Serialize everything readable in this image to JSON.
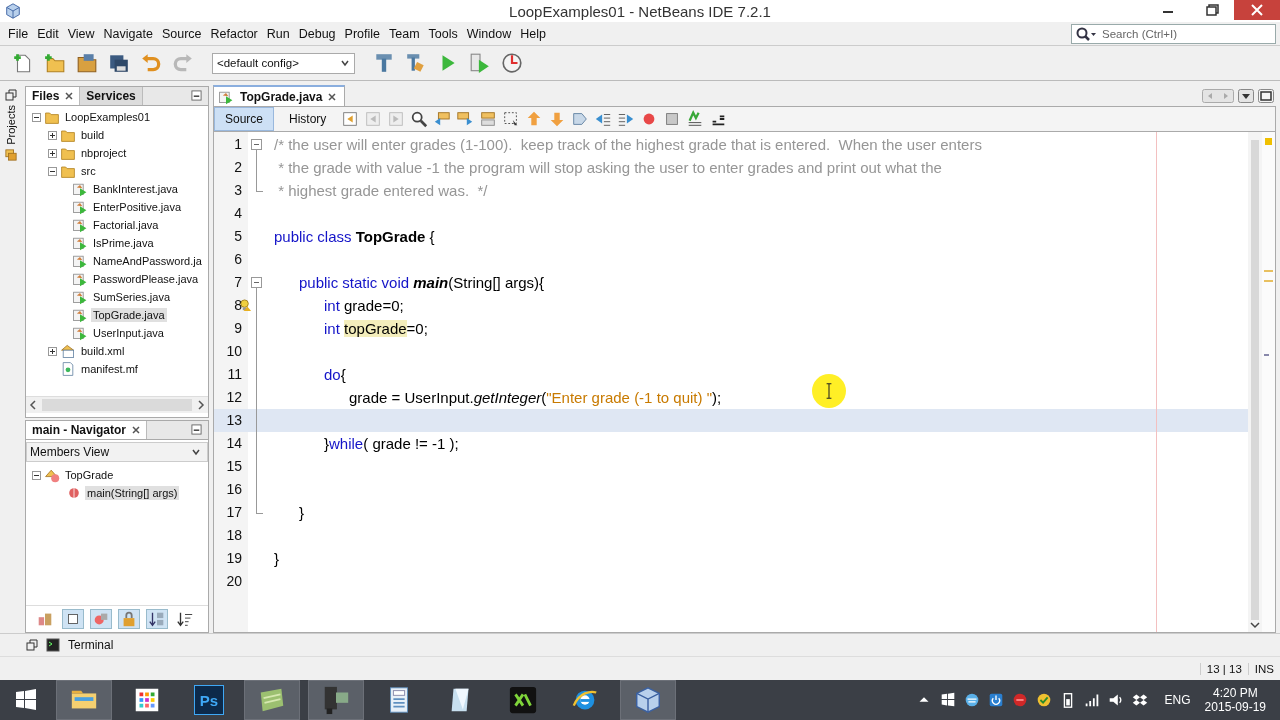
{
  "window": {
    "title": "LoopExamples01 - NetBeans IDE 7.2.1"
  },
  "menu": [
    "File",
    "Edit",
    "View",
    "Navigate",
    "Source",
    "Refactor",
    "Run",
    "Debug",
    "Profile",
    "Team",
    "Tools",
    "Window",
    "Help"
  ],
  "search": {
    "placeholder": "Search (Ctrl+I)"
  },
  "toolbar": {
    "config": "<default config>"
  },
  "side_strip": {
    "label": "Projects"
  },
  "files_panel": {
    "tabs": [
      {
        "label": "Files",
        "selected": true
      },
      {
        "label": "Services",
        "selected": false
      }
    ],
    "tree": [
      {
        "label": "LoopExamples01",
        "kind": "project",
        "expanded": true,
        "selected": false,
        "children": [
          {
            "label": "build",
            "kind": "folder",
            "expanded": false,
            "selected": false
          },
          {
            "label": "nbproject",
            "kind": "folder",
            "expanded": false,
            "selected": false
          },
          {
            "label": "src",
            "kind": "folder",
            "expanded": true,
            "selected": false,
            "children": [
              {
                "label": "BankInterest.java",
                "kind": "java",
                "selected": false
              },
              {
                "label": "EnterPositive.java",
                "kind": "java",
                "selected": false
              },
              {
                "label": "Factorial.java",
                "kind": "java",
                "selected": false
              },
              {
                "label": "IsPrime.java",
                "kind": "java",
                "selected": false
              },
              {
                "label": "NameAndPassword.ja",
                "kind": "java",
                "selected": false
              },
              {
                "label": "PasswordPlease.java",
                "kind": "java",
                "selected": false
              },
              {
                "label": "SumSeries.java",
                "kind": "java",
                "selected": false
              },
              {
                "label": "TopGrade.java",
                "kind": "java",
                "selected": true
              },
              {
                "label": "UserInput.java",
                "kind": "java",
                "selected": false
              }
            ]
          },
          {
            "label": "build.xml",
            "kind": "xml",
            "expanded": false,
            "selected": false
          },
          {
            "label": "manifest.mf",
            "kind": "manifest",
            "selected": false
          }
        ]
      }
    ]
  },
  "navigator": {
    "title": "main - Navigator",
    "view": "Members View",
    "tree": [
      {
        "label": "TopGrade",
        "kind": "class",
        "expanded": true,
        "selected": false,
        "children": [
          {
            "label": "main(String[] args)",
            "kind": "method",
            "selected": true
          }
        ]
      }
    ]
  },
  "editor": {
    "tabs": [
      {
        "label": "TopGrade.java",
        "selected": true
      }
    ],
    "views": [
      {
        "label": "Source",
        "selected": true
      },
      {
        "label": "History",
        "selected": false
      }
    ],
    "lines": [
      {
        "number": "1",
        "expanded": true,
        "hint": false,
        "current": false,
        "tokens": [
          {
            "kind": "comment",
            "text": "/* the user will enter grades (1-100).  keep track of the highest grade that is entered.  When the user enters"
          }
        ],
        "children": [
          {
            "number": "2",
            "hint": false,
            "current": false,
            "tokens": [
              {
                "kind": "comment",
                "text": " * the grade with value -1 the program will stop asking the user to enter grades and print out what the"
              }
            ]
          },
          {
            "number": "3",
            "hint": false,
            "current": false,
            "tokens": [
              {
                "kind": "comment",
                "text": " * highest grade entered was.  */"
              }
            ]
          }
        ]
      },
      {
        "number": "4",
        "hint": false,
        "current": false
      },
      {
        "number": "5",
        "hint": false,
        "current": false,
        "tokens": [
          {
            "kind": "kw",
            "text": "public class "
          },
          {
            "kind": "cls",
            "text": "TopGrade"
          },
          {
            "kind": "plain",
            "text": " {"
          }
        ]
      },
      {
        "number": "6",
        "hint": false,
        "current": false
      },
      {
        "number": "7",
        "expanded": true,
        "hint": false,
        "current": false,
        "tokens": [
          {
            "kind": "kw",
            "text": "      public static void "
          },
          {
            "kind": "method",
            "text": "main"
          },
          {
            "kind": "plain",
            "text": "(String[] args){"
          }
        ],
        "children": [
          {
            "number": "8",
            "hint": true,
            "current": false,
            "tokens": [
              {
                "kind": "kw",
                "text": "            int "
              },
              {
                "kind": "plain",
                "text": "grade=0;"
              }
            ]
          },
          {
            "number": "9",
            "hint": false,
            "current": false,
            "tokens": [
              {
                "kind": "kw",
                "text": "            int "
              },
              {
                "kind": "hl",
                "text": "topGrade"
              },
              {
                "kind": "plain",
                "text": "=0;"
              }
            ]
          },
          {
            "number": "10",
            "hint": false,
            "current": false
          },
          {
            "number": "11",
            "hint": false,
            "current": false,
            "tokens": [
              {
                "kind": "kw",
                "text": "            do"
              },
              {
                "kind": "plain",
                "text": "{"
              }
            ]
          },
          {
            "number": "12",
            "hint": false,
            "current": false,
            "tokens": [
              {
                "kind": "plain",
                "text": "                  grade = UserInput."
              },
              {
                "kind": "call",
                "text": "getInteger"
              },
              {
                "kind": "plain",
                "text": "("
              },
              {
                "kind": "str",
                "text": "\"Enter grade (-1 to quit) \""
              },
              {
                "kind": "plain",
                "text": ");"
              }
            ]
          },
          {
            "number": "13",
            "hint": false,
            "current": true
          },
          {
            "number": "14",
            "hint": false,
            "current": false,
            "tokens": [
              {
                "kind": "plain",
                "text": "            }"
              },
              {
                "kind": "kw",
                "text": "while"
              },
              {
                "kind": "plain",
                "text": "( grade != -1 );"
              }
            ]
          },
          {
            "number": "15",
            "hint": false,
            "current": false
          },
          {
            "number": "16",
            "hint": false,
            "current": false
          },
          {
            "number": "17",
            "hint": false,
            "current": false,
            "tokens": [
              {
                "kind": "plain",
                "text": "      }"
              }
            ]
          }
        ]
      },
      {
        "number": "18",
        "hint": false,
        "current": false
      },
      {
        "number": "19",
        "hint": false,
        "current": false,
        "tokens": [
          {
            "kind": "plain",
            "text": "}"
          }
        ]
      },
      {
        "number": "20",
        "hint": false,
        "current": false
      }
    ]
  },
  "bottom_bar": {
    "label": "Terminal"
  },
  "status_bar": {
    "position": "13 | 13",
    "mode": "INS"
  },
  "taskbar": {
    "apps": [
      {
        "kind": "explorer",
        "running": true
      },
      {
        "kind": "apps",
        "running": false
      },
      {
        "kind": "photoshop",
        "label": "Ps",
        "running": false
      },
      {
        "kind": "notes",
        "running": true
      },
      {
        "kind": "camera",
        "running": true
      },
      {
        "kind": "calculator",
        "running": false
      },
      {
        "kind": "notepad",
        "running": false
      },
      {
        "kind": "xampp",
        "running": false
      },
      {
        "kind": "browser",
        "running": false
      },
      {
        "kind": "netbeans",
        "running": true
      }
    ],
    "language": "ENG",
    "time": "4:20 PM",
    "date": "2015-09-19"
  }
}
